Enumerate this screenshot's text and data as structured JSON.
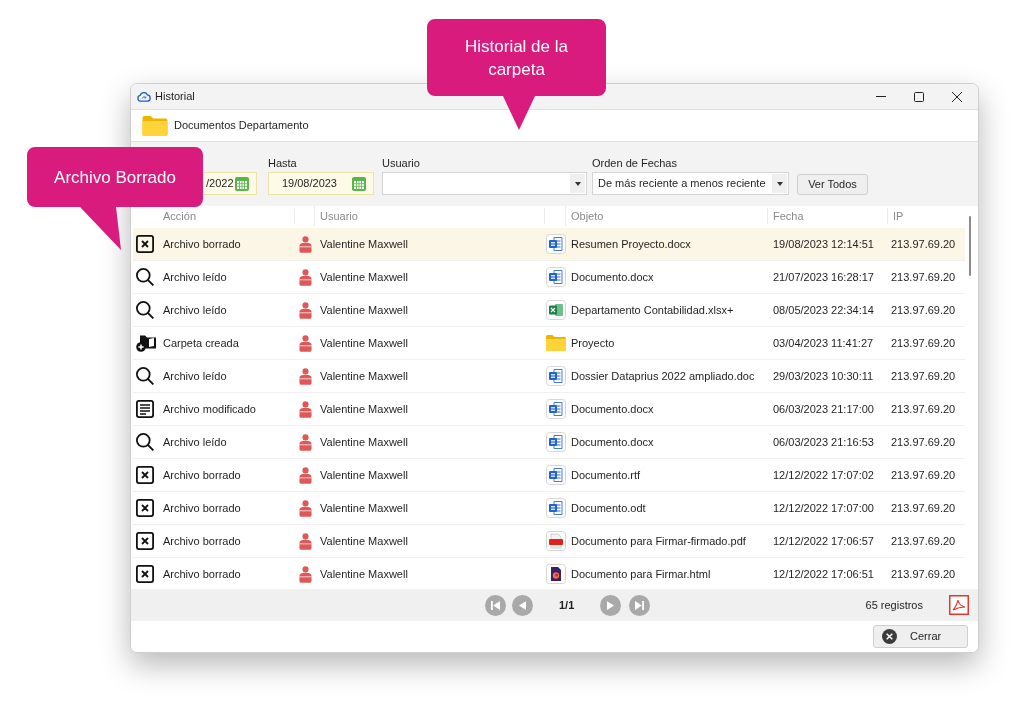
{
  "window": {
    "title": "Historial"
  },
  "folder": {
    "name": "Documentos Departamento"
  },
  "filters": {
    "desde": {
      "value": "/2022"
    },
    "hasta": {
      "label": "Hasta",
      "value": "19/08/2023"
    },
    "usuario": {
      "label": "Usuario"
    },
    "orden": {
      "label": "Orden de Fechas",
      "value": "De más reciente a menos reciente"
    },
    "ver_todos": "Ver Todos"
  },
  "table": {
    "columns": [
      "Acción",
      "Usuario",
      "Objeto",
      "Fecha",
      "IP"
    ],
    "rows": [
      {
        "selected": true,
        "action": {
          "kind": "deleted",
          "text": "Archivo borrado"
        },
        "user": "Valentine Maxwell",
        "object": {
          "kind": "word",
          "name": "Resumen Proyecto.docx"
        },
        "date": "19/08/2023 12:14:51",
        "ip": "213.97.69.20"
      },
      {
        "selected": false,
        "action": {
          "kind": "read",
          "text": "Archivo leído"
        },
        "user": "Valentine Maxwell",
        "object": {
          "kind": "word",
          "name": "Documento.docx"
        },
        "date": "21/07/2023 16:28:17",
        "ip": "213.97.69.20"
      },
      {
        "selected": false,
        "action": {
          "kind": "read",
          "text": "Archivo leído"
        },
        "user": "Valentine Maxwell",
        "object": {
          "kind": "excel",
          "name": "Departamento Contabilidad.xlsx+"
        },
        "date": "08/05/2023 22:34:14",
        "ip": "213.97.69.20"
      },
      {
        "selected": false,
        "action": {
          "kind": "created",
          "text": "Carpeta creada"
        },
        "user": "Valentine Maxwell",
        "object": {
          "kind": "folder",
          "name": "Proyecto"
        },
        "date": "03/04/2023 11:41:27",
        "ip": "213.97.69.20"
      },
      {
        "selected": false,
        "action": {
          "kind": "read",
          "text": "Archivo leído"
        },
        "user": "Valentine Maxwell",
        "object": {
          "kind": "word",
          "name": "Dossier Dataprius 2022 ampliado.doc"
        },
        "date": "29/03/2023 10:30:11",
        "ip": "213.97.69.20"
      },
      {
        "selected": false,
        "action": {
          "kind": "modified",
          "text": "Archivo modificado"
        },
        "user": "Valentine Maxwell",
        "object": {
          "kind": "word",
          "name": "Documento.docx"
        },
        "date": "06/03/2023 21:17:00",
        "ip": "213.97.69.20"
      },
      {
        "selected": false,
        "action": {
          "kind": "read",
          "text": "Archivo leído"
        },
        "user": "Valentine Maxwell",
        "object": {
          "kind": "word",
          "name": "Documento.docx"
        },
        "date": "06/03/2023 21:16:53",
        "ip": "213.97.69.20"
      },
      {
        "selected": false,
        "action": {
          "kind": "deleted",
          "text": "Archivo borrado"
        },
        "user": "Valentine Maxwell",
        "object": {
          "kind": "word",
          "name": "Documento.rtf"
        },
        "date": "12/12/2022 17:07:02",
        "ip": "213.97.69.20"
      },
      {
        "selected": false,
        "action": {
          "kind": "deleted",
          "text": "Archivo borrado"
        },
        "user": "Valentine Maxwell",
        "object": {
          "kind": "word",
          "name": "Documento.odt"
        },
        "date": "12/12/2022 17:07:00",
        "ip": "213.97.69.20"
      },
      {
        "selected": false,
        "action": {
          "kind": "deleted",
          "text": "Archivo borrado"
        },
        "user": "Valentine Maxwell",
        "object": {
          "kind": "pdf",
          "name": "Documento para Firmar-firmado.pdf"
        },
        "date": "12/12/2022 17:06:57",
        "ip": "213.97.69.20"
      },
      {
        "selected": false,
        "action": {
          "kind": "deleted",
          "text": "Archivo borrado"
        },
        "user": "Valentine Maxwell",
        "object": {
          "kind": "html",
          "name": "Documento para Firmar.html"
        },
        "date": "12/12/2022 17:06:51",
        "ip": "213.97.69.20"
      }
    ]
  },
  "pager": {
    "page": "1/1",
    "count": "65 registros"
  },
  "close_button": "Cerrar",
  "callouts": [
    {
      "text": "Historial de la carpeta"
    },
    {
      "text": "Archivo Borrado"
    }
  ]
}
